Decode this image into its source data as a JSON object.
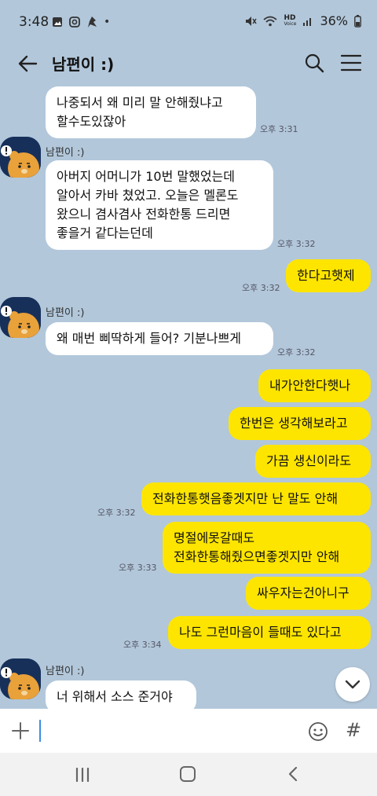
{
  "status_bar": {
    "time": "3:48",
    "dot": "•",
    "network": "HD",
    "network_sub": "Voice",
    "battery": "36%"
  },
  "header": {
    "title": "남편이 :)"
  },
  "messages": [
    {
      "side": "other",
      "text": "나중되서 왜 미리 말 안해줬냐고\n할수도있잖아",
      "time": "오후 3:31"
    },
    {
      "side": "other",
      "sender": "남편이 :)",
      "text": "아버지 어머니가 10번 말했었는데\n알아서 카바 쳤었고. 오늘은 멜론도\n왔으니 겸사겸사 전화한통 드리면\n좋을거 같다는던데",
      "time": "오후 3:32"
    },
    {
      "side": "me",
      "text": "한다고햇제",
      "time": "오후 3:32"
    },
    {
      "side": "other",
      "sender": "남편이 :)",
      "text": "왜 매번 삐딱하게 들어? 기분나쁘게",
      "time": "오후 3:32"
    },
    {
      "side": "me",
      "text": "내가안한다햇나"
    },
    {
      "side": "me",
      "text": "한번은 생각해보라고"
    },
    {
      "side": "me",
      "text": "가끔 생신이라도"
    },
    {
      "side": "me",
      "text": "전화한통햇음좋겟지만 난 말도 안해",
      "time": "오후 3:32"
    },
    {
      "side": "me",
      "text": "명절에못갈때도\n전화한통해줬으면좋겟지만 안해",
      "time": "오후 3:33"
    },
    {
      "side": "me",
      "text": "싸우자는건아니구"
    },
    {
      "side": "me",
      "text": "나도 그런마음이 들때도 있다고",
      "time": "오후 3:34"
    },
    {
      "side": "other",
      "sender": "남편이 :)",
      "text": "너 위해서 소스 준거야"
    }
  ],
  "colors": {
    "background": "#b2c7da",
    "my_bubble": "#fee500",
    "other_bubble": "#ffffff"
  },
  "icons": [
    "back-arrow-icon",
    "search-icon",
    "menu-icon",
    "plus-icon",
    "emoji-icon",
    "hash-icon",
    "chevron-down-icon"
  ]
}
